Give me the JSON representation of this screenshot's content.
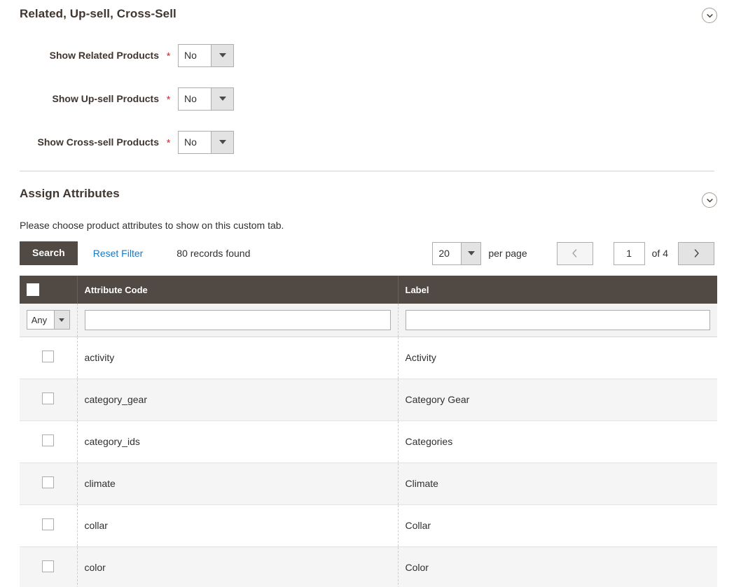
{
  "related_section": {
    "title": "Related, Up-sell, Cross-Sell",
    "toggle_icon": "chevron-down-circle-icon",
    "fields": [
      {
        "label": "Show Related Products",
        "required_mark": "*",
        "value": "No"
      },
      {
        "label": "Show Up-sell Products",
        "required_mark": "*",
        "value": "No"
      },
      {
        "label": "Show Cross-sell Products",
        "required_mark": "*",
        "value": "No"
      }
    ]
  },
  "assign_section": {
    "title": "Assign Attributes",
    "toggle_icon": "chevron-down-circle-icon",
    "help_text": "Please choose product attributes to show on this custom tab.",
    "toolbar": {
      "search_label": "Search",
      "reset_filter_label": "Reset Filter",
      "records_found": "80 records found"
    },
    "pager": {
      "per_page_value": "20",
      "per_page_label": "per page",
      "prev_icon": "chevron-left-icon",
      "next_icon": "chevron-right-icon",
      "current_page": "1",
      "total_pages_label": "of 4"
    },
    "grid": {
      "columns": [
        "",
        "Attribute Code",
        "Label"
      ],
      "filters": {
        "select_value": "Any",
        "attribute_code_value": "",
        "label_value": ""
      },
      "rows": [
        {
          "code": "activity",
          "label": "Activity"
        },
        {
          "code": "category_gear",
          "label": "Category Gear"
        },
        {
          "code": "category_ids",
          "label": "Categories"
        },
        {
          "code": "climate",
          "label": "Climate"
        },
        {
          "code": "collar",
          "label": "Collar"
        },
        {
          "code": "color",
          "label": "Color"
        }
      ]
    }
  },
  "colors": {
    "header_bg": "#514943",
    "accent_link": "#1979c3",
    "required": "#e02b27",
    "stripe": "#f5f5f5"
  }
}
